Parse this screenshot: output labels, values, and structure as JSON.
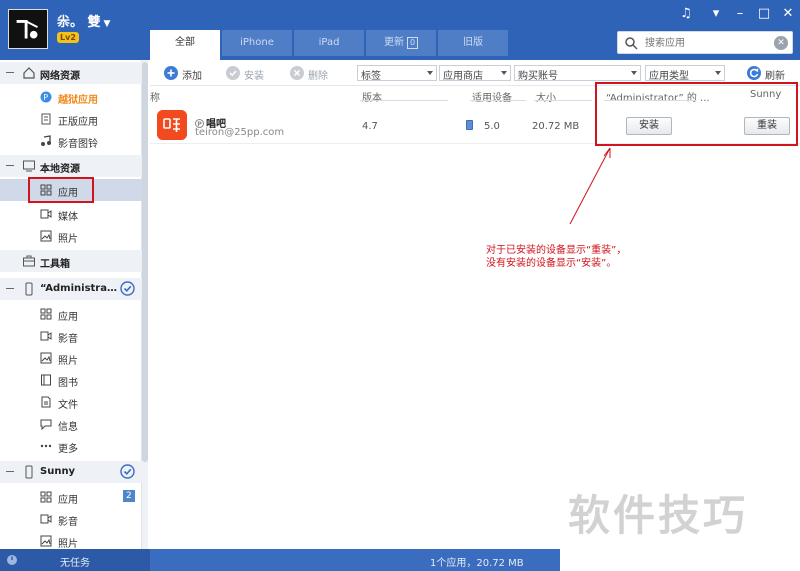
{
  "header": {
    "username": "尜。 雙",
    "level": "Lv2",
    "tabs": [
      "全部",
      "iPhone",
      "iPad",
      "更新",
      "旧版"
    ],
    "update_badge": "0",
    "search_placeholder": "搜索应用"
  },
  "sidebar": {
    "sections": [
      {
        "label": "网络资源",
        "items": [
          "越狱应用",
          "正版应用",
          "影音图铃"
        ]
      },
      {
        "label": "本地资源",
        "items": [
          "应用",
          "媒体",
          "照片"
        ]
      },
      {
        "label": "工具箱",
        "items": []
      },
      {
        "label": "“Administra…",
        "items": [
          "应用",
          "影音",
          "照片",
          "图书",
          "文件",
          "信息",
          "更多"
        ]
      },
      {
        "label": "Sunny",
        "items": [
          "应用",
          "影音",
          "照片"
        ]
      }
    ],
    "sunny_app_count": "2"
  },
  "toolbar": {
    "add": "添加",
    "install": "安装",
    "delete": "删除",
    "filters": [
      "标签",
      "应用商店",
      "购买账号",
      "应用类型"
    ],
    "refresh": "刷新"
  },
  "table": {
    "headers": [
      "称",
      "版本",
      "适用设备",
      "大小",
      "“Administrator” 的 ...",
      "Sunny"
    ],
    "rows": [
      {
        "name": "唱吧",
        "developer": "teiron@25pp.com",
        "version": "4.7",
        "device_ver": "5.0",
        "size": "20.72 MB",
        "admin_action": "安装",
        "sunny_action": "重装"
      }
    ]
  },
  "status": {
    "task": "无任务",
    "summary": "1个应用，20.72 MB"
  },
  "annotation": {
    "line1": "对于已安装的设备显示“重装”，",
    "line2": "没有安装的设备显示“安装”。"
  },
  "watermark": "软件技巧",
  "colors": {
    "header": "#2f63b7",
    "accent_orange": "#f08c1e",
    "annotation_red": "#d0131c"
  }
}
